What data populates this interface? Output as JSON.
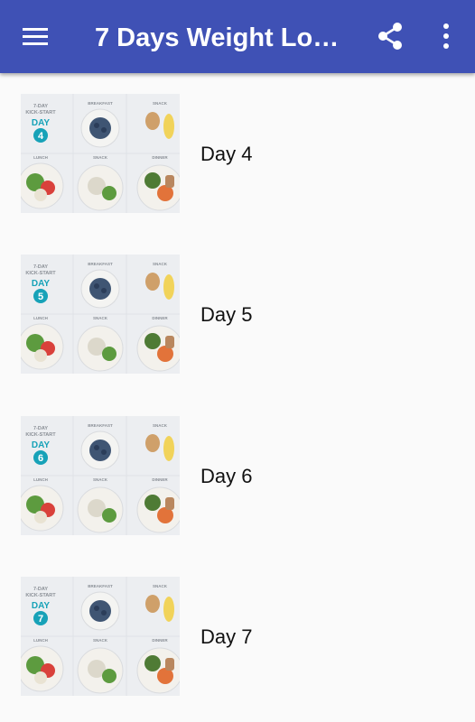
{
  "appbar": {
    "title": "7 Days Weight Loss…",
    "menu_icon": "hamburger-menu-icon",
    "share_icon": "share-icon",
    "more_icon": "more-vertical-icon",
    "background": "#3f51b5"
  },
  "list": {
    "items": [
      {
        "label": "Day 4",
        "thumb": {
          "badge_top": "7-DAY",
          "badge_mid": "KICK-START",
          "badge_day": "DAY",
          "day_num": "4",
          "sec_breakfast": "BREAKFAST",
          "sec_snack1": "SNACK",
          "sec_lunch": "LUNCH",
          "sec_snack2": "SNACK",
          "sec_dinner": "DINNER"
        }
      },
      {
        "label": "Day 5",
        "thumb": {
          "badge_top": "7-DAY",
          "badge_mid": "KICK-START",
          "badge_day": "DAY",
          "day_num": "5",
          "sec_breakfast": "BREAKFAST",
          "sec_snack1": "SNACK",
          "sec_lunch": "LUNCH",
          "sec_snack2": "SNACK",
          "sec_dinner": "DINNER"
        }
      },
      {
        "label": "Day 6",
        "thumb": {
          "badge_top": "7-DAY",
          "badge_mid": "KICK-START",
          "badge_day": "DAY",
          "day_num": "6",
          "sec_breakfast": "BREAKFAST",
          "sec_snack1": "SNACK",
          "sec_lunch": "LUNCH",
          "sec_snack2": "SNACK",
          "sec_dinner": "DINNER"
        }
      },
      {
        "label": "Day 7",
        "thumb": {
          "badge_top": "7-DAY",
          "badge_mid": "KICK-START",
          "badge_day": "DAY",
          "day_num": "7",
          "sec_breakfast": "BREAKFAST",
          "sec_snack1": "SNACK",
          "sec_lunch": "LUNCH",
          "sec_snack2": "SNACK",
          "sec_dinner": "DINNER"
        }
      }
    ]
  },
  "colors": {
    "badge_teal": "#17a2b8",
    "text": "#111111"
  }
}
